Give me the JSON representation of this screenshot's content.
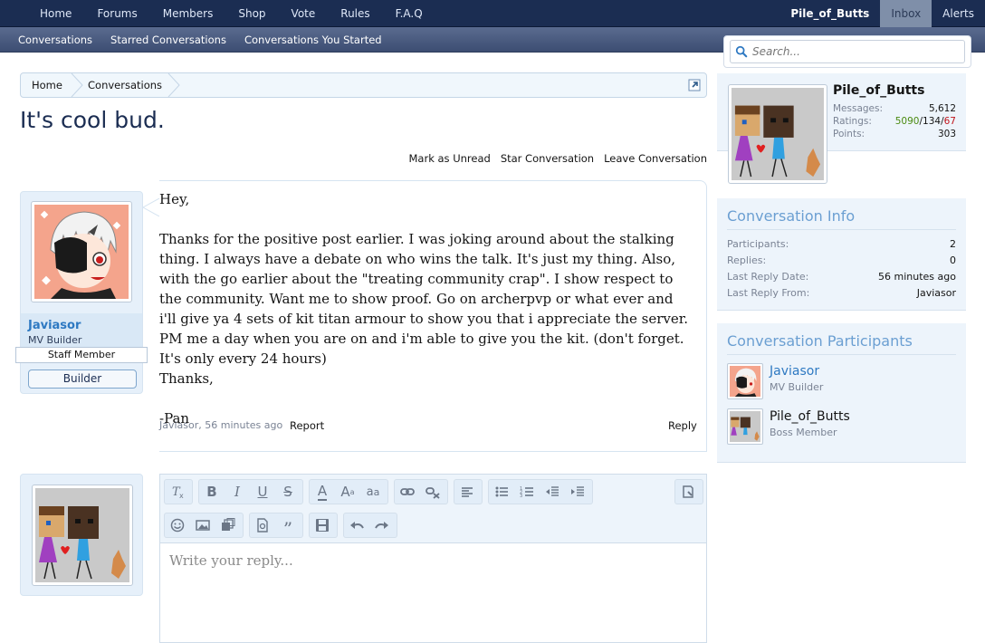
{
  "nav": {
    "tabs": [
      "Home",
      "Forums",
      "Members",
      "Shop",
      "Vote",
      "Rules",
      "F.A.Q"
    ],
    "username": "Pile_of_Butts",
    "inbox": "Inbox",
    "alerts": "Alerts"
  },
  "subnav": {
    "links": [
      "Conversations",
      "Starred Conversations",
      "Conversations You Started"
    ]
  },
  "search": {
    "placeholder": "Search..."
  },
  "breadcrumb": {
    "home": "Home",
    "current": "Conversations"
  },
  "conversation": {
    "title": "It's cool bud.",
    "actions": [
      "Mark as Unread",
      "Star Conversation",
      "Leave Conversation"
    ]
  },
  "message": {
    "author": "Javiasor",
    "author_title": "MV Builder",
    "staff_badge": "Staff Member",
    "role_badge": "Builder",
    "lines": [
      "Hey,",
      "",
      "Thanks for the positive post earlier. I was joking around about the stalking thing. I always have a debate on who wins the talk. It's just my thing. Also, with the go earlier about the \"treating community crap\". I show respect to the community. Want me to show proof. Go on archerpvp or what ever and i'll give ya 4 sets of kit titan armour to show you that i appreciate the server. PM me a day when you are on and i'm able to give you the kit. (don't forget. It's only every 24 hours)",
      "Thanks,",
      "",
      "-Pan"
    ],
    "meta": "Javiasor, 56 minutes ago",
    "report": "Report",
    "reply": "Reply"
  },
  "editor": {
    "placeholder": "Write your reply..."
  },
  "sidebar": {
    "user": {
      "name": "Pile_of_Butts",
      "messages_label": "Messages:",
      "messages": "5,612",
      "ratings_label": "Ratings:",
      "ratings_pos": "5090",
      "ratings_neu": "134",
      "ratings_neg": "67",
      "points_label": "Points:",
      "points": "303"
    },
    "info": {
      "title": "Conversation Info",
      "rows": [
        {
          "k": "Participants:",
          "v": "2"
        },
        {
          "k": "Replies:",
          "v": "0"
        },
        {
          "k": "Last Reply Date:",
          "v": "56 minutes ago"
        },
        {
          "k": "Last Reply From:",
          "v": "Javiasor"
        }
      ]
    },
    "participants": {
      "title": "Conversation Participants",
      "list": [
        {
          "name": "Javiasor",
          "title": "MV Builder"
        },
        {
          "name": "Pile_of_Butts",
          "title": "Boss Member"
        }
      ]
    }
  },
  "colors": {
    "nav_bg": "#1b2d52",
    "accent": "#2e79c2",
    "sidebar_title": "#6b9fd2",
    "rating_pos": "#4a8a10",
    "rating_neg": "#c0141b"
  }
}
